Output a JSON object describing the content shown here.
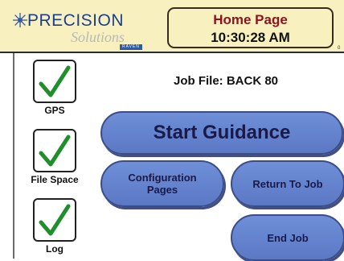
{
  "header": {
    "logo_main": "PRECISION",
    "logo_sub": "Solutions",
    "logo_badge": "RAVEN",
    "title": "Home Page",
    "time": "10:30:28 AM",
    "corner_mark": "0"
  },
  "sidebar": {
    "items": [
      {
        "label": "GPS",
        "status": "ok"
      },
      {
        "label": "File Space",
        "status": "ok"
      },
      {
        "label": "Log",
        "status": "ok"
      }
    ]
  },
  "main": {
    "job_file": "Job File: BACK 80",
    "start_guidance": "Start Guidance",
    "config_line1": "Configuration",
    "config_line2": "Pages",
    "return_to_job": "Return To Job",
    "end_job": "End Job"
  },
  "colors": {
    "header_bg": "#f8f0be",
    "title_red": "#8f1320",
    "button_blue": "#5b78c4",
    "check_green": "#1e8f2a"
  },
  "icons": {
    "status": "checkmark-icon",
    "logo": "star-icon"
  }
}
